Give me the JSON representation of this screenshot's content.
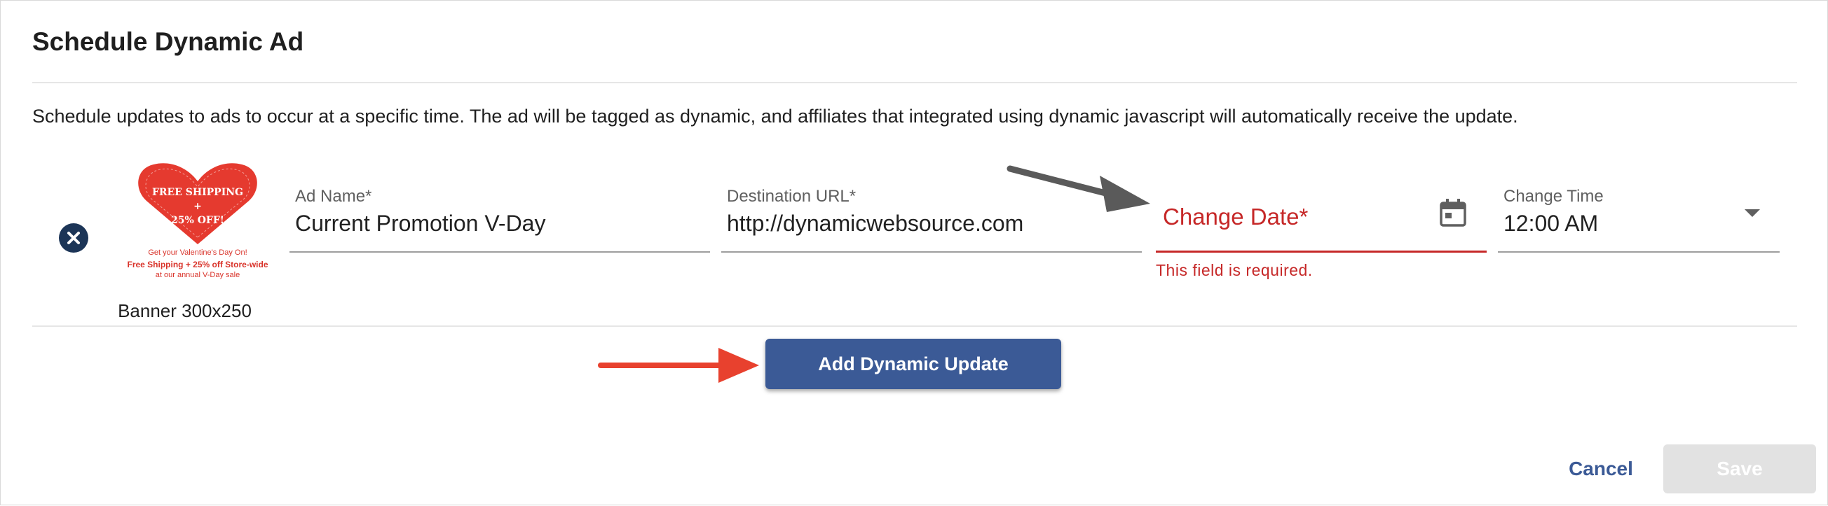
{
  "dialog": {
    "title": "Schedule Dynamic Ad",
    "description": "Schedule updates to ads to occur at a specific time. The ad will be tagged as dynamic, and affiliates that integrated using dynamic javascript will automatically receive the update."
  },
  "ad_row": {
    "thumbnail": {
      "heart_line1": "FREE SHIPPING",
      "heart_line2": "+",
      "heart_line3": "25% OFF!",
      "caption1": "Get your Valentine's Day On!",
      "caption2": "Free Shipping + 25% off Store-wide",
      "caption3": "at our annual V-Day sale",
      "label": "Banner 300x250"
    },
    "ad_name": {
      "label": "Ad Name*",
      "value": "Current Promotion V-Day"
    },
    "destination_url": {
      "label": "Destination URL*",
      "value": "http://dynamicwebsource.com"
    },
    "change_date": {
      "placeholder": "Change Date*",
      "error": "This field is required.",
      "icon": "calendar-icon"
    },
    "change_time": {
      "label": "Change Time",
      "value": "12:00 AM",
      "icon": "dropdown-arrow-icon"
    },
    "remove_icon": "close-circle-icon"
  },
  "actions": {
    "add_update_label": "Add Dynamic Update",
    "cancel_label": "Cancel",
    "save_label": "Save"
  },
  "colors": {
    "primary": "#3b5a96",
    "error": "#c62828",
    "remove_button": "#1c3557",
    "annotation_red": "#e8412e",
    "annotation_gray": "#5a5a5a"
  }
}
